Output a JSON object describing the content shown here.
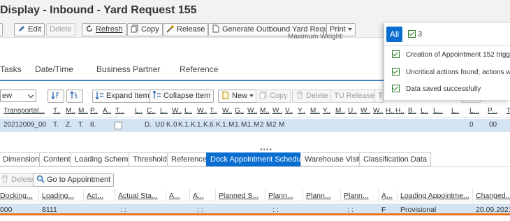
{
  "window": {
    "title": "Display - Inbound - Yard Request 155"
  },
  "toolbar": {
    "edit": "Edit",
    "delete": "Delete",
    "refresh": "Refresh",
    "copy": "Copy",
    "release": "Release",
    "generate": "Generate Outbound Yard Request",
    "print": "Print"
  },
  "hidden_field": "Maximum Weight:",
  "tabs": [
    "Tasks",
    "Date/Time",
    "Business Partner",
    "Reference"
  ],
  "items_toolbar": {
    "view_value": "ew",
    "expand": "Expand Item",
    "collapse": "Collapse Item",
    "new": "New",
    "copy": "Copy",
    "delete": "Delete",
    "tu_release": "TU Release",
    "cut1": "T",
    "cut2": "tion"
  },
  "items_grid": {
    "headers": [
      "Transportat...",
      "T..",
      "M..",
      "M..",
      "P..",
      "A..",
      "T...",
      "L..",
      "C..",
      "L..",
      "W..",
      "L..",
      "W..",
      "T..",
      "W..",
      "G..",
      "W..",
      "M..",
      "W..",
      "V..",
      "Y..",
      "M..",
      "Y..",
      "M..",
      "U..",
      "W..",
      "W..",
      "H..",
      "H..",
      "B..",
      "L..",
      "L...",
      "L..",
      "L...",
      "P...",
      "T"
    ],
    "row": [
      "20212009_00",
      "T.",
      "Z.",
      "T.",
      "8.",
      "D.",
      "U.",
      "0",
      "K.",
      "0",
      "K.",
      "1.",
      "K.",
      "1.",
      "K.",
      "6.",
      "K.",
      "1.",
      "M.",
      "1.",
      "M.",
      "1.",
      "M",
      "2",
      "M",
      "2",
      "M",
      "0",
      "00"
    ]
  },
  "splitter": "••••",
  "sub_tabs": [
    "Dimensions",
    "Content",
    "Loading Scheme",
    "Threshold",
    "Reference",
    "Dock Appointment Scheduling",
    "Warehouse Visits",
    "Classification Data"
  ],
  "appt_toolbar": {
    "delete": "Delete",
    "goto": "Go to Appointment"
  },
  "appt_grid": {
    "headers": [
      "Docking...",
      "Loading...",
      "Act...",
      "Actual Sta...",
      "A...",
      "A...",
      "Planned S...",
      "Plann...",
      "Plann...",
      "Plann...",
      "A...",
      "Loading Appointme...",
      "Changed..."
    ],
    "row": [
      "000",
      "8111",
      "",
      ": :",
      "",
      ": :",
      "",
      ": :",
      "",
      ": :",
      "F",
      "Provisional",
      "20.09.2021"
    ]
  },
  "popup": {
    "filter_all": "All",
    "count": "3",
    "messages": [
      "Creation of Appointment 152 triggered",
      "Uncritical actions found; actions will be",
      "Data saved successfully"
    ]
  },
  "colors": {
    "accent": "#0a6ed1",
    "row_selected": "#d4e4f3",
    "highlight": "#e8761e",
    "success": "#2b7d2b"
  }
}
